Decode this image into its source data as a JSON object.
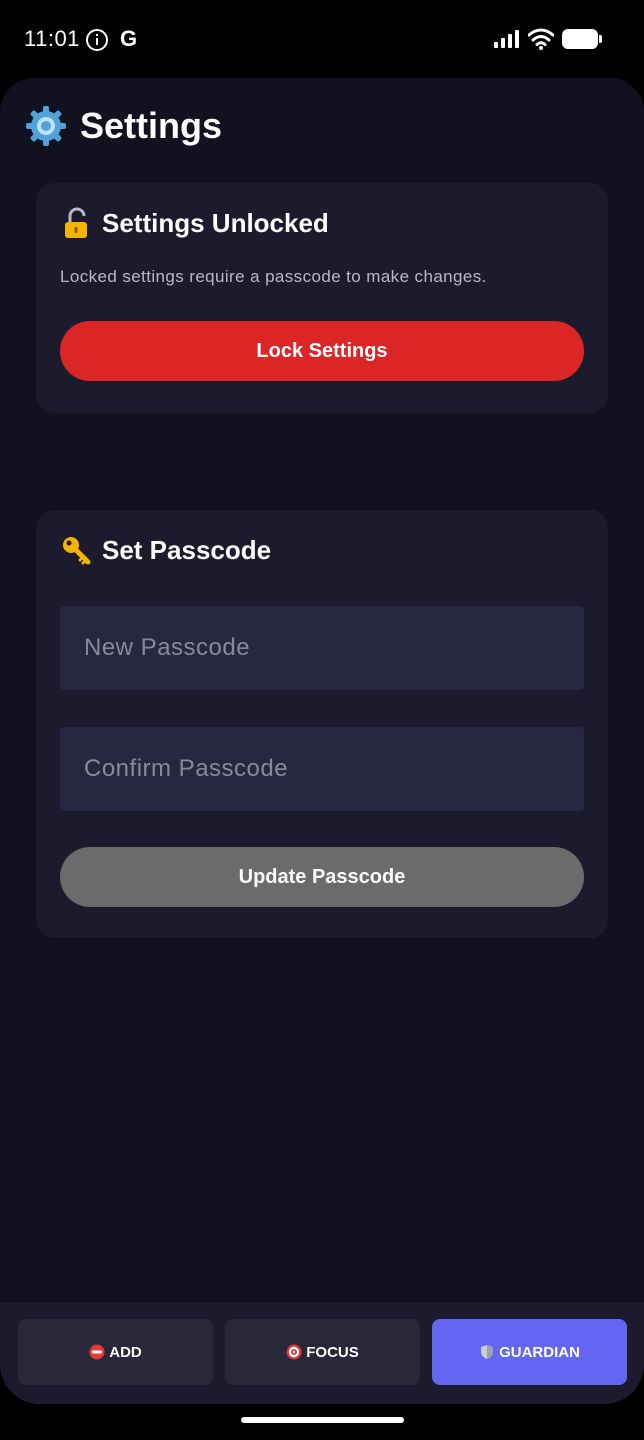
{
  "status_bar": {
    "time": "11:01",
    "icons": [
      "info-icon",
      "google-icon",
      "signal-icon",
      "wifi-icon",
      "battery-icon"
    ],
    "google_glyph": "G"
  },
  "header": {
    "icon": "gear-icon",
    "title": "Settings"
  },
  "lock_card": {
    "icon": "unlocked-padlock-icon",
    "title": "Settings Unlocked",
    "description": "Locked settings require a passcode to make changes.",
    "button_label": "Lock Settings",
    "button_color": "#dc2626"
  },
  "passcode_card": {
    "icon": "key-icon",
    "title": "Set Passcode",
    "new_passcode": {
      "value": "",
      "placeholder": "New Passcode"
    },
    "confirm_passcode": {
      "value": "",
      "placeholder": "Confirm Passcode"
    },
    "button_label": "Update Passcode",
    "button_color": "#6b6b6b"
  },
  "bottom_nav": {
    "items": [
      {
        "label": "ADD",
        "icon": "no-entry-icon",
        "active": false
      },
      {
        "label": "FOCUS",
        "icon": "target-icon",
        "active": false
      },
      {
        "label": "GUARDIAN",
        "icon": "shield-icon",
        "active": true
      }
    ],
    "active_color": "#6366f1"
  },
  "colors": {
    "background": "#12111f",
    "card": "#1c1b2e",
    "input": "#282741",
    "accent": "#6366f1",
    "danger": "#dc2626"
  }
}
